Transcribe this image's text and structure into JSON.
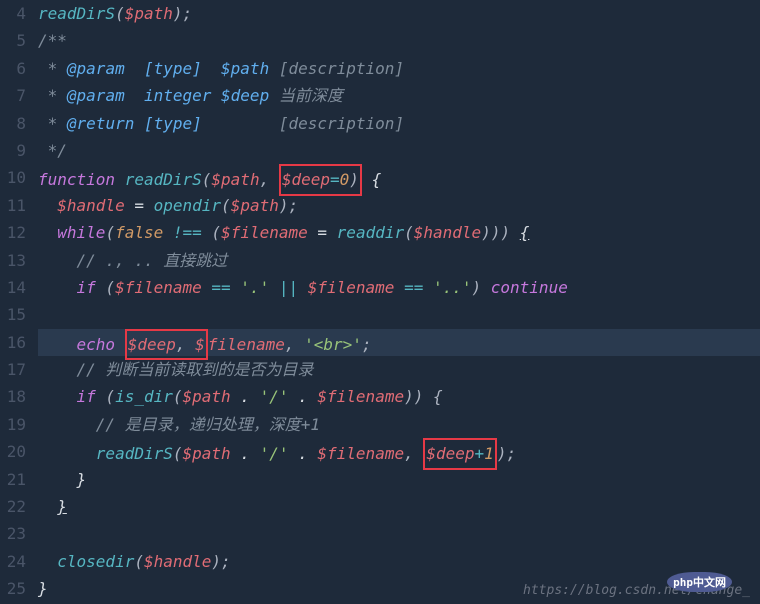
{
  "gutter": [
    "4",
    "5",
    "6",
    "7",
    "8",
    "9",
    "10",
    "11",
    "12",
    "13",
    "14",
    "15",
    "16",
    "17",
    "18",
    "19",
    "20",
    "21",
    "22",
    "23",
    "24",
    "25"
  ],
  "tokens": {
    "l4_fn": "readDirS",
    "l4_p": "(",
    "l4_var": "$path",
    "l4_p2": ");",
    "l5_doc": "/**",
    "l6_star": " * ",
    "l6_tag": "@param",
    "l6_type": "  [type]  ",
    "l6_var": "$path",
    "l6_desc": " [description]",
    "l7_star": " * ",
    "l7_tag": "@param",
    "l7_type": "  integer ",
    "l7_var": "$deep",
    "l7_desc": " 当前深度",
    "l8_star": " * ",
    "l8_tag": "@return",
    "l8_type": " [type]        ",
    "l8_desc": "[description]",
    "l9_doc": " */",
    "l10_kw": "function",
    "l10_fn": " readDirS",
    "l10_p1": "(",
    "l10_var1": "$path",
    "l10_c": ", ",
    "l10_var2": "$deep",
    "l10_eq": "=",
    "l10_num": "0",
    "l10_p2": ")",
    "l10_b": " {",
    "l11_var1": "$handle",
    "l11_eq": " = ",
    "l11_fn": "opendir",
    "l11_p1": "(",
    "l11_var2": "$path",
    "l11_p2": ");",
    "l12_kw": "while",
    "l12_p1": "(",
    "l12_false": "false",
    "l12_neq": " !== ",
    "l12_p2": "(",
    "l12_var1": "$filename",
    "l12_eq": " = ",
    "l12_fn": "readdir",
    "l12_p3": "(",
    "l12_var2": "$handle",
    "l12_p4": "))) ",
    "l12_b": "{",
    "l13_cmt": "// ., .. 直接跳过",
    "l14_kw": "if",
    "l14_p1": " (",
    "l14_var1": "$filename",
    "l14_eq1": " == ",
    "l14_str1": "'.'",
    "l14_or": " || ",
    "l14_var2": "$filename",
    "l14_eq2": " == ",
    "l14_str2": "'..'",
    "l14_p2": ") ",
    "l14_cont": "continue",
    "l16_echo": "echo",
    "l16_sp": " ",
    "l16_var1": "$deep",
    "l16_c1": ", ",
    "l16_var2": "$",
    "l16_var2b": "filename",
    "l16_c2": ", ",
    "l16_str": "'<br>'",
    "l16_sc": ";",
    "l17_cmt": "// 判断当前读取到的是否为目录",
    "l18_kw": "if",
    "l18_p1": " (",
    "l18_fn": "is_dir",
    "l18_p2": "(",
    "l18_var1": "$path",
    "l18_dot1": " . ",
    "l18_str": "'/'",
    "l18_dot2": " . ",
    "l18_var2": "$filename",
    "l18_p3": ")) {",
    "l19_cmt": "// 是目录，递归处理，深度+1",
    "l20_fn": "readDirS",
    "l20_p1": "(",
    "l20_var1": "$path",
    "l20_dot1": " . ",
    "l20_str": "'/'",
    "l20_dot2": " . ",
    "l20_var2": "$filename",
    "l20_c": ", ",
    "l20_var3": "$deep",
    "l20_plus": "+",
    "l20_num": "1",
    "l20_p2": ");",
    "l21_b": "}",
    "l22_b": "}",
    "l24_fn": "closedir",
    "l24_p1": "(",
    "l24_var": "$handle",
    "l24_p2": ");",
    "l25_b": "}"
  },
  "watermark": "https://blog.csdn.net/change_",
  "badge": "php中文网"
}
